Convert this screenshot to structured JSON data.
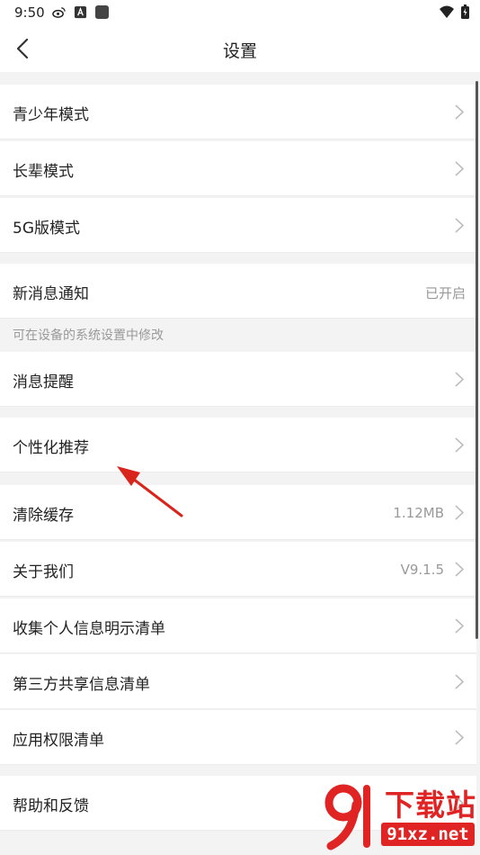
{
  "status_bar": {
    "time": "9:50",
    "icons_left": [
      "weibo-icon",
      "a-icon",
      "square-icon"
    ],
    "icons_right": [
      "wifi-icon",
      "battery-icon"
    ]
  },
  "nav": {
    "title": "设置",
    "back_icon": "chevron-left-icon"
  },
  "groups": [
    {
      "items": [
        {
          "label": "青少年模式",
          "value": "",
          "chevron": true
        },
        {
          "label": "长辈模式",
          "value": "",
          "chevron": true
        },
        {
          "label": "5G版模式",
          "value": "",
          "chevron": true
        }
      ]
    },
    {
      "items": [
        {
          "label": "新消息通知",
          "value": "已开启",
          "chevron": false
        }
      ],
      "hint": "可在设备的系统设置中修改"
    },
    {
      "items": [
        {
          "label": "消息提醒",
          "value": "",
          "chevron": true
        }
      ]
    },
    {
      "items": [
        {
          "label": "个性化推荐",
          "value": "",
          "chevron": true
        }
      ]
    },
    {
      "items": [
        {
          "label": "清除缓存",
          "value": "1.12MB",
          "chevron": true
        },
        {
          "label": "关于我们",
          "value": "V9.1.5",
          "chevron": true
        },
        {
          "label": "收集个人信息明示清单",
          "value": "",
          "chevron": true
        },
        {
          "label": "第三方共享信息清单",
          "value": "",
          "chevron": true
        },
        {
          "label": "应用权限清单",
          "value": "",
          "chevron": true
        }
      ]
    },
    {
      "items": [
        {
          "label": "帮助和反馈",
          "value": "",
          "chevron": true
        }
      ]
    }
  ],
  "watermark": {
    "main": "下载站",
    "sub": "91xz.net"
  },
  "colors": {
    "arrow": "#d9241c",
    "watermark": "#e02424"
  }
}
